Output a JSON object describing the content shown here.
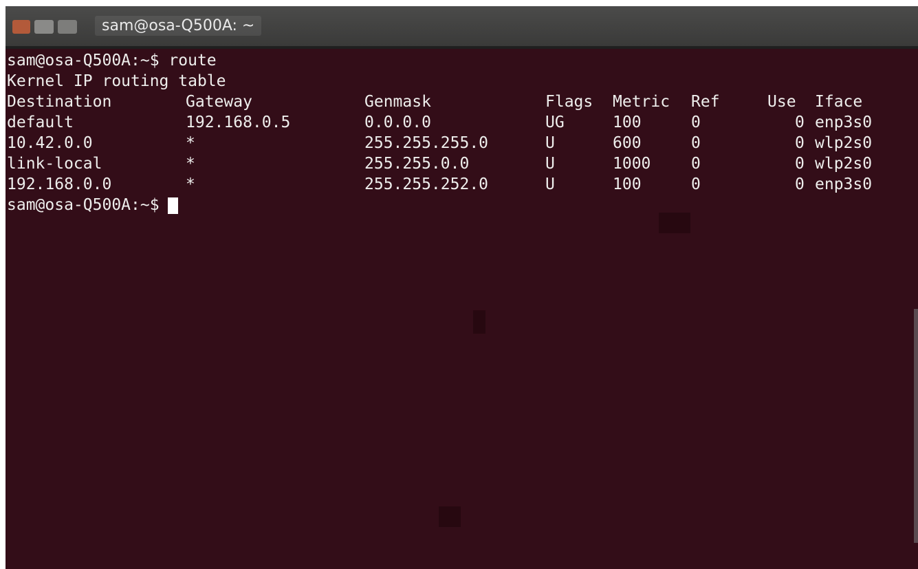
{
  "window": {
    "title": "sam@osa-Q500A: ~",
    "controls": [
      "close-button",
      "minimize-button",
      "maximize-button"
    ]
  },
  "terminal": {
    "command_line": {
      "prompt": "sam@osa-Q500A:~$",
      "command": "route"
    },
    "header": "Kernel IP routing table",
    "columns": [
      "Destination",
      "Gateway",
      "Genmask",
      "Flags",
      "Metric",
      "Ref",
      "Use",
      "Iface"
    ],
    "rows": [
      {
        "destination": "default",
        "gateway": "192.168.0.5",
        "genmask": "0.0.0.0",
        "flags": "UG",
        "metric": "100",
        "ref": "0",
        "use": "0",
        "iface": "enp3s0"
      },
      {
        "destination": "10.42.0.0",
        "gateway": "*",
        "genmask": "255.255.255.0",
        "flags": "U",
        "metric": "600",
        "ref": "0",
        "use": "0",
        "iface": "wlp2s0"
      },
      {
        "destination": "link-local",
        "gateway": "*",
        "genmask": "255.255.0.0",
        "flags": "U",
        "metric": "1000",
        "ref": "0",
        "use": "0",
        "iface": "wlp2s0"
      },
      {
        "destination": "192.168.0.0",
        "gateway": "*",
        "genmask": "255.255.252.0",
        "flags": "U",
        "metric": "100",
        "ref": "0",
        "use": "0",
        "iface": "enp3s0"
      }
    ],
    "current_prompt": "sam@osa-Q500A:~$"
  },
  "colors": {
    "background": "#330d18",
    "foreground": "#eeeeec",
    "titlebar": "#3f3f3e"
  }
}
